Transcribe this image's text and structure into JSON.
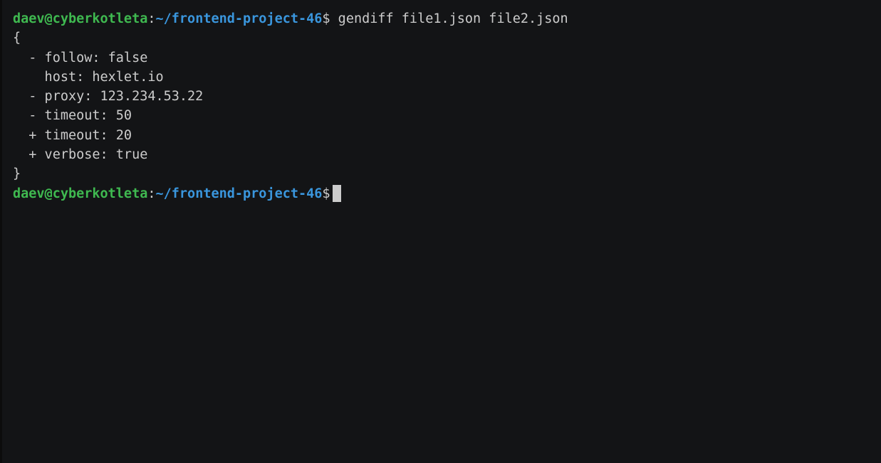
{
  "colors": {
    "background": "#131416",
    "text": "#cccccc",
    "prompt_user": "#3fb950",
    "prompt_path": "#3a96dd"
  },
  "prompt": {
    "user_host": "daev@cyberkotleta",
    "separator": ":",
    "path": "~/frontend-project-46",
    "symbol": "$"
  },
  "command": " gendiff file1.json file2.json",
  "output": [
    "{",
    "  - follow: false",
    "    host: hexlet.io",
    "  - proxy: 123.234.53.22",
    "  - timeout: 50",
    "  + timeout: 20",
    "  + verbose: true",
    "}"
  ]
}
